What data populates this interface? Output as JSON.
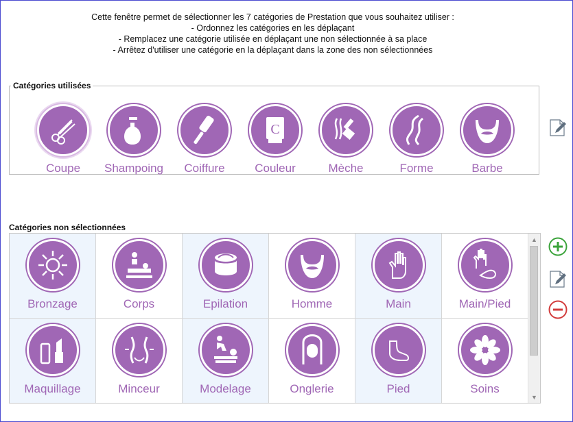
{
  "instructions": [
    "Cette fenêtre permet de sélectionner les 7 catégories de Prestation que vous souhaitez utiliser :",
    "- Ordonnez les catégories en les déplaçant",
    "- Remplacez une catégorie utilisée en déplaçant une non sélectionnée à sa place",
    "- Arrêtez d'utiliser une catégorie en la déplaçant dans la zone des non sélectionnées"
  ],
  "used": {
    "title": "Catégories utilisées",
    "items": [
      {
        "label": "Coupe",
        "icon": "scissors-comb-icon"
      },
      {
        "label": "Shampoing",
        "icon": "shampoo-bottle-icon"
      },
      {
        "label": "Coiffure",
        "icon": "hairbrush-icon"
      },
      {
        "label": "Couleur",
        "icon": "color-tube-icon"
      },
      {
        "label": "Mèche",
        "icon": "highlight-brush-icon"
      },
      {
        "label": "Forme",
        "icon": "curl-icon"
      },
      {
        "label": "Barbe",
        "icon": "beard-icon"
      }
    ]
  },
  "unselected": {
    "title": "Catégories non sélectionnées",
    "items": [
      {
        "label": "Bronzage",
        "icon": "sun-icon"
      },
      {
        "label": "Corps",
        "icon": "body-massage-icon"
      },
      {
        "label": "Epilation",
        "icon": "wax-jar-icon"
      },
      {
        "label": "Homme",
        "icon": "beard-icon"
      },
      {
        "label": "Main",
        "icon": "hand-icon"
      },
      {
        "label": "Main/Pied",
        "icon": "hand-foot-icon"
      },
      {
        "label": "Maquillage",
        "icon": "lipstick-icon"
      },
      {
        "label": "Minceur",
        "icon": "waist-icon"
      },
      {
        "label": "Modelage",
        "icon": "massage-icon"
      },
      {
        "label": "Onglerie",
        "icon": "nail-icon"
      },
      {
        "label": "Pied",
        "icon": "foot-icon"
      },
      {
        "label": "Soins",
        "icon": "flower-icon"
      }
    ]
  },
  "colors": {
    "accent": "#a067b5",
    "add": "#3aa33a",
    "remove": "#d23b3b"
  }
}
